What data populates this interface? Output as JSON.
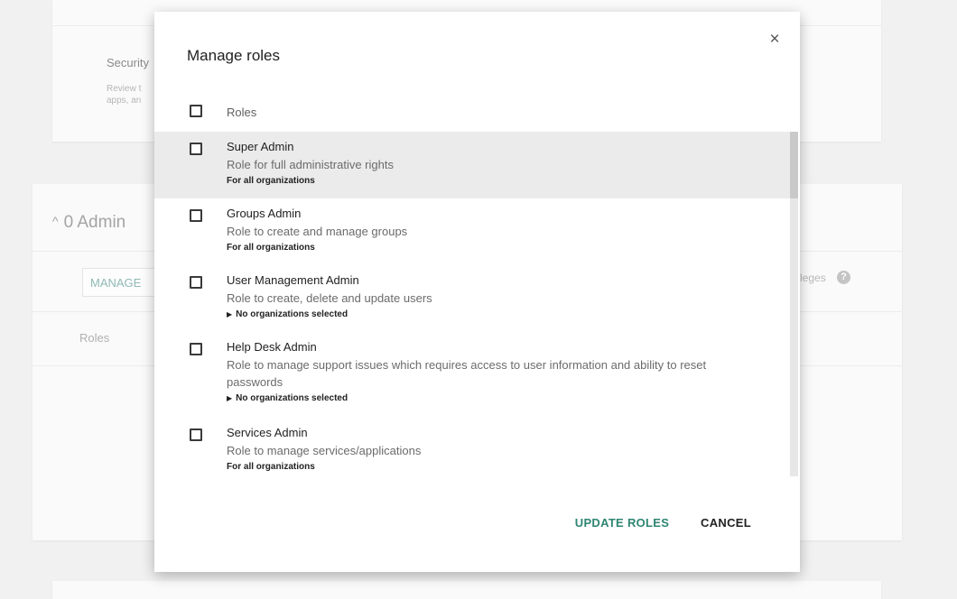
{
  "background": {
    "security_title": "Security",
    "security_desc_line1": "Review t",
    "security_desc_line2": "apps, an",
    "admins_heading": "0 Admin",
    "admins_chevron": "^",
    "manage_button": "MANAGE",
    "roles_label": "Roles",
    "privileges_text": "leges",
    "help_icon": "?"
  },
  "dialog": {
    "title": "Manage roles",
    "close_icon": "×",
    "header_label": "Roles",
    "roles": [
      {
        "name": "Super Admin",
        "description": "Role for full administrative rights",
        "scope": "For all organizations",
        "scope_expandable": false,
        "selected": true
      },
      {
        "name": "Groups Admin",
        "description": "Role to create and manage groups",
        "scope": "For all organizations",
        "scope_expandable": false,
        "selected": false
      },
      {
        "name": "User Management Admin",
        "description": "Role to create, delete and update users",
        "scope": "No organizations selected",
        "scope_expandable": true,
        "selected": false
      },
      {
        "name": "Help Desk Admin",
        "description": "Role to manage support issues which requires access to user information and ability to reset passwords",
        "scope": "No organizations selected",
        "scope_expandable": true,
        "selected": false
      },
      {
        "name": "Services Admin",
        "description": "Role to manage services/applications",
        "scope": "For all organizations",
        "scope_expandable": false,
        "selected": false
      }
    ],
    "update_button": "UPDATE ROLES",
    "cancel_button": "CANCEL",
    "accent_color": "#2f8573"
  }
}
